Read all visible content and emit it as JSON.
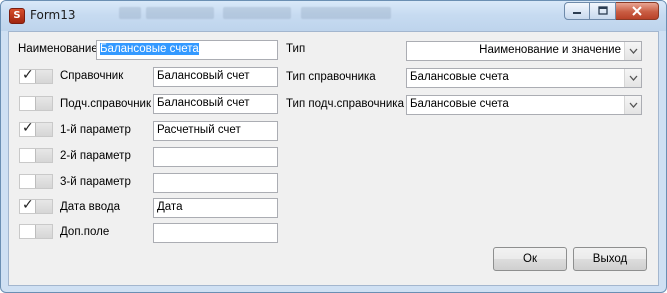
{
  "window": {
    "title": "Form13",
    "app_icon_letter": "S"
  },
  "form": {
    "name_label": "Наименование",
    "name_value": "Балансовые счета",
    "type_label": "Тип",
    "type_value": "Наименование и значение",
    "reference_label": "Справочник",
    "reference_checked": true,
    "reference_value": "Балансовый счет",
    "reference_type_label": "Тип справочника",
    "reference_type_value": "Балансовые счета",
    "subreference_label": "Подч.справочник",
    "subreference_checked": false,
    "subreference_value": "Балансовый счет",
    "subreference_type_label": "Тип подч.справочника",
    "subreference_type_value": "Балансовые счета",
    "param1_label": "1-й параметр",
    "param1_checked": true,
    "param1_value": "Расчетный счет",
    "param2_label": "2-й параметр",
    "param2_checked": false,
    "param2_value": "",
    "param3_label": "3-й параметр",
    "param3_checked": false,
    "param3_value": "",
    "entry_date_label": "Дата ввода",
    "entry_date_checked": true,
    "entry_date_value": "Дата",
    "extra_field_label": "Доп.поле",
    "extra_field_checked": false,
    "extra_field_value": ""
  },
  "buttons": {
    "ok": "Ок",
    "exit": "Выход"
  },
  "icons": {
    "minimize": "minimize-icon",
    "maximize": "maximize-icon",
    "close": "close-icon",
    "dropdown": "chevron-down-icon",
    "check": "checkmark-icon"
  },
  "colors": {
    "selection": "#3399ff",
    "close_button": "#c95d43",
    "frame": "#cfe0f3"
  }
}
